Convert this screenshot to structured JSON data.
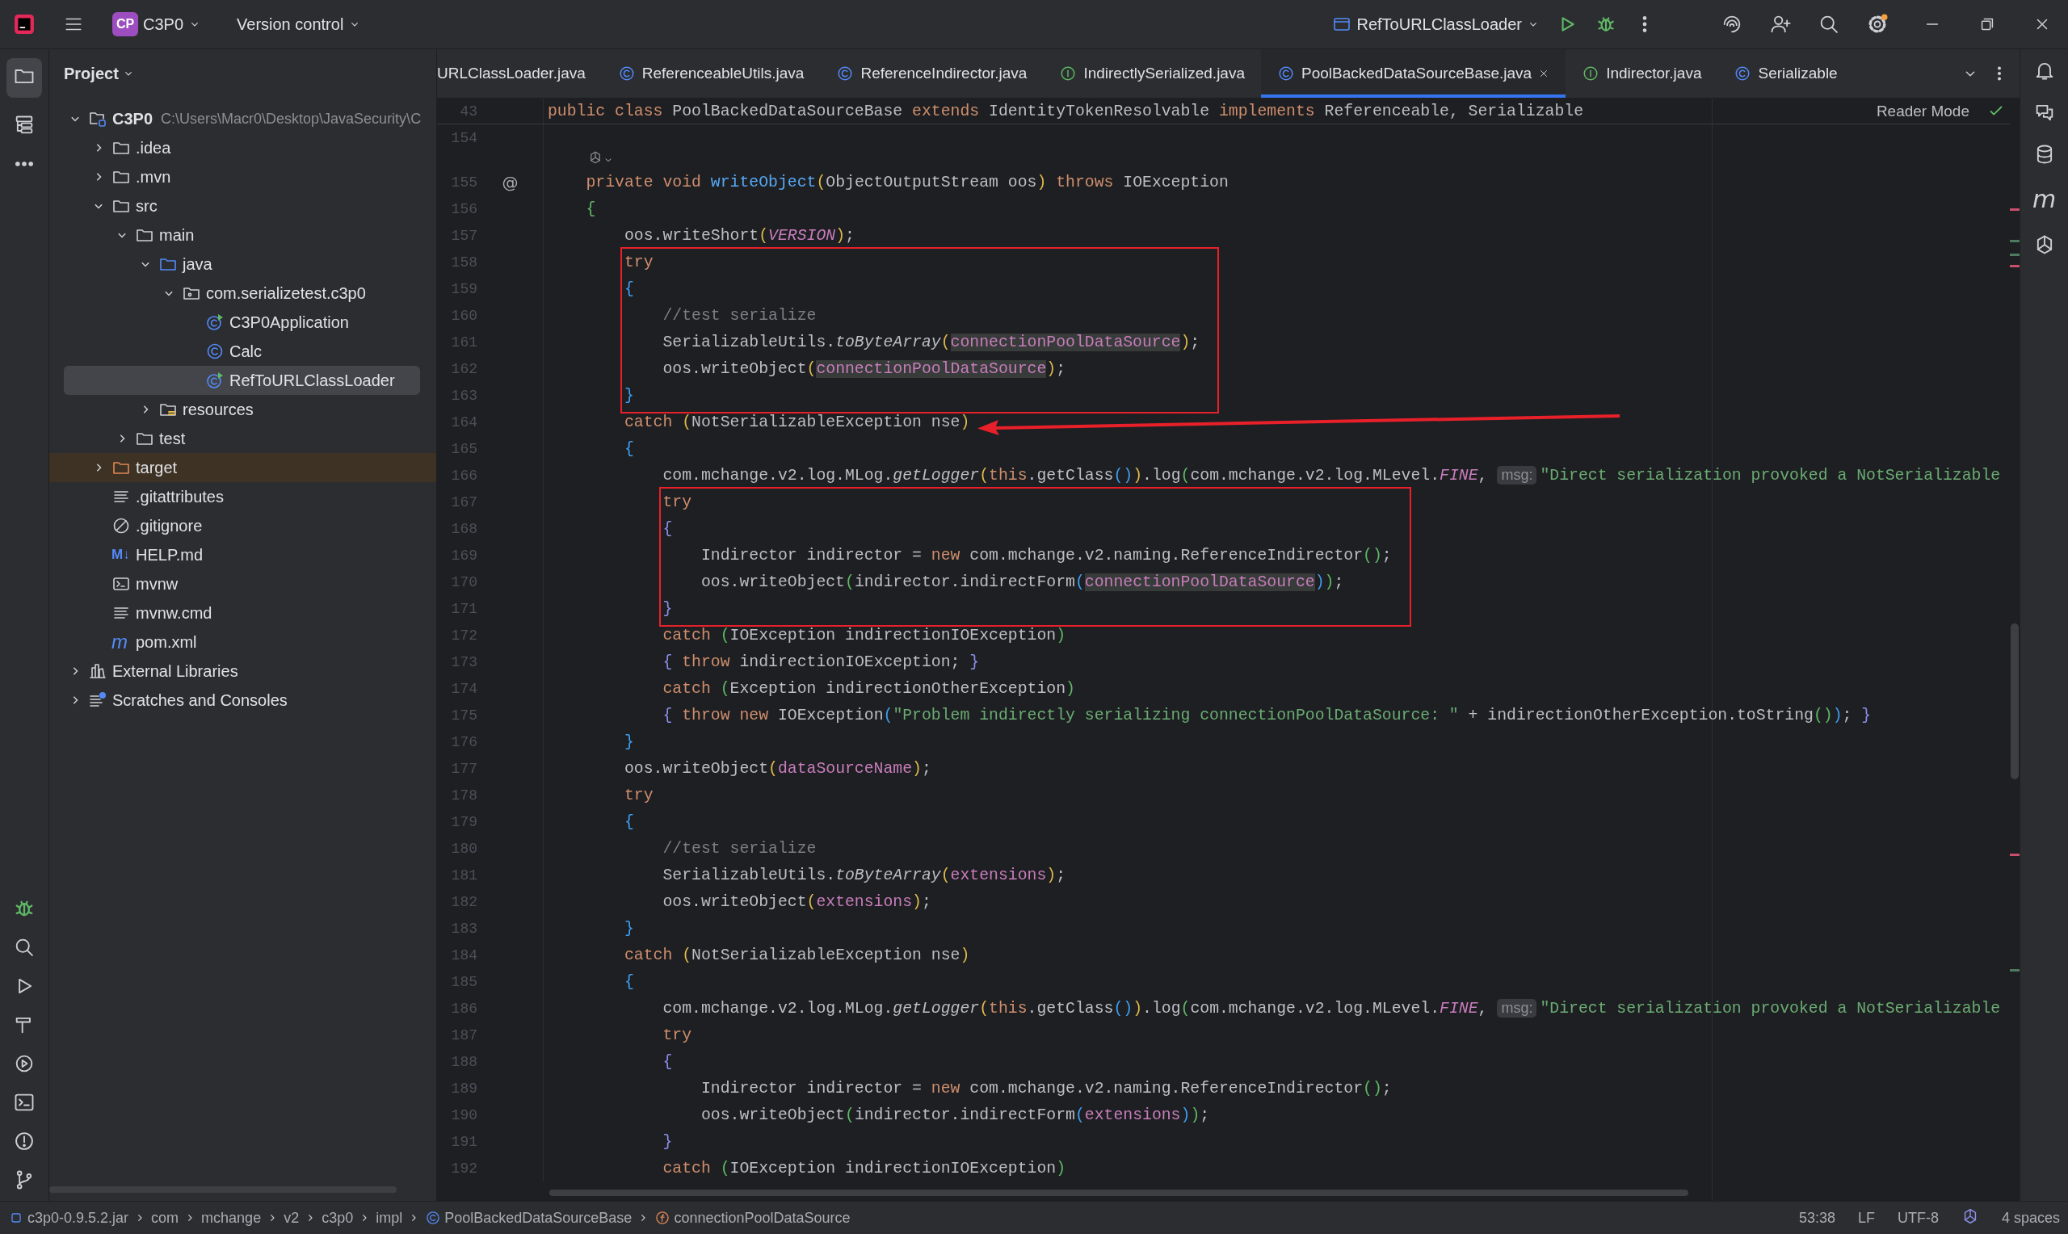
{
  "title_bar": {
    "project_badge": "CP",
    "project_name": "C3P0",
    "vcs_label": "Version control",
    "run_config": "RefToURLClassLoader"
  },
  "project_panel": {
    "title": "Project",
    "tree": [
      {
        "name": "C3P0",
        "path": "C:\\Users\\Macr0\\Desktop\\JavaSecurity\\C",
        "kind": "module",
        "expanded": true,
        "selected": false,
        "children": [
          {
            "name": ".idea",
            "kind": "folder",
            "expanded": false,
            "selected": false
          },
          {
            "name": ".mvn",
            "kind": "folder",
            "expanded": false,
            "selected": false
          },
          {
            "name": "src",
            "kind": "folder",
            "expanded": true,
            "selected": false,
            "children": [
              {
                "name": "main",
                "kind": "folder",
                "expanded": true,
                "selected": false,
                "children": [
                  {
                    "name": "java",
                    "kind": "source-folder",
                    "expanded": true,
                    "selected": false,
                    "children": [
                      {
                        "name": "com.serializetest.c3p0",
                        "kind": "package",
                        "expanded": true,
                        "selected": false,
                        "children": [
                          {
                            "name": "C3P0Application",
                            "kind": "main-class",
                            "selected": false
                          },
                          {
                            "name": "Calc",
                            "kind": "class",
                            "selected": false
                          },
                          {
                            "name": "RefToURLClassLoader",
                            "kind": "main-class",
                            "selected": true
                          }
                        ]
                      }
                    ]
                  },
                  {
                    "name": "resources",
                    "kind": "resources",
                    "expanded": false,
                    "selected": false
                  }
                ]
              },
              {
                "name": "test",
                "kind": "folder",
                "expanded": false,
                "selected": false
              }
            ]
          },
          {
            "name": "target",
            "kind": "excluded-folder",
            "expanded": false,
            "selected": false
          },
          {
            "name": ".gitattributes",
            "kind": "text",
            "selected": false
          },
          {
            "name": ".gitignore",
            "kind": "ignore",
            "selected": false
          },
          {
            "name": "HELP.md",
            "kind": "glyph",
            "icon_text": "M↓",
            "selected": false
          },
          {
            "name": "mvnw",
            "kind": "script",
            "selected": false
          },
          {
            "name": "mvnw.cmd",
            "kind": "text",
            "selected": false
          },
          {
            "name": "pom.xml",
            "kind": "glyph",
            "icon_text": "m",
            "selected": false
          }
        ]
      },
      {
        "name": "External Libraries",
        "kind": "libraries",
        "expanded": false,
        "selected": false
      },
      {
        "name": "Scratches and Consoles",
        "kind": "scratches",
        "expanded": false,
        "selected": false
      }
    ]
  },
  "editor": {
    "tabs": [
      {
        "label": "URLClassLoader.java",
        "selected": false
      },
      {
        "label": "ReferenceableUtils.java",
        "kind": "class",
        "selected": false
      },
      {
        "label": "ReferenceIndirector.java",
        "kind": "class",
        "selected": false
      },
      {
        "label": "IndirectlySerialized.java",
        "kind": "interface",
        "selected": false
      },
      {
        "label": "PoolBackedDataSourceBase.java",
        "kind": "class",
        "selected": true
      },
      {
        "label": "Indirector.java",
        "kind": "interface",
        "selected": false
      },
      {
        "label": "Serializable",
        "kind": "class",
        "selected": false
      }
    ],
    "reader_mode": "Reader Mode",
    "sticky_line": {
      "number": "43",
      "tokens": [
        {
          "text": "public class ",
          "kind": "kw"
        },
        {
          "text": "PoolBackedDataSourceBase ",
          "kind": "plain"
        },
        {
          "text": "extends ",
          "kind": "kw"
        },
        {
          "text": "IdentityTokenResolvable ",
          "kind": "plain"
        },
        {
          "text": "implements ",
          "kind": "kw"
        },
        {
          "text": "Referenceable, Serializable",
          "kind": "plain"
        }
      ]
    },
    "blocks": [
      {
        "kind": "plain",
        "lines": [
          {
            "kind": "code",
            "number": "154"
          },
          {
            "kind": "inlay"
          },
          {
            "kind": "code",
            "number": "155",
            "marker": "@",
            "tokens": [
              {
                "text": "    private void ",
                "kind": "kw"
              },
              {
                "text": "writeObject",
                "kind": "fn"
              },
              {
                "text": "(",
                "kind": "y"
              },
              {
                "text": "ObjectOutputStream oos",
                "kind": "plain"
              },
              {
                "text": ")",
                "kind": "y"
              },
              {
                "text": " throws ",
                "kind": "kw"
              },
              {
                "text": "IOException",
                "kind": "plain"
              }
            ]
          },
          {
            "kind": "code",
            "number": "156",
            "tokens": [
              {
                "text": "    {",
                "kind": "g"
              }
            ]
          },
          {
            "kind": "code",
            "number": "157",
            "tokens": [
              {
                "text": "        oos.writeShort",
                "kind": "plain"
              },
              {
                "text": "(",
                "kind": "y"
              },
              {
                "text": "VERSION",
                "kind": "const"
              },
              {
                "text": ")",
                "kind": "y"
              },
              {
                "text": ";",
                "kind": "plain"
              }
            ]
          }
        ]
      },
      {
        "kind": "boxed",
        "lines": [
          {
            "kind": "code",
            "number": "158",
            "tokens": [
              {
                "text": "        try",
                "kind": "kw"
              }
            ]
          },
          {
            "kind": "code",
            "number": "159",
            "tokens": [
              {
                "text": "        {",
                "kind": "b"
              }
            ]
          },
          {
            "kind": "code",
            "number": "160",
            "tokens": [
              {
                "text": "            //test serialize",
                "kind": "comment"
              }
            ]
          },
          {
            "kind": "code",
            "number": "161",
            "tokens": [
              {
                "text": "            SerializableUtils.",
                "kind": "plain"
              },
              {
                "text": "toByteArray",
                "kind": "static"
              },
              {
                "text": "(",
                "kind": "y"
              },
              {
                "text": "connectionPoolDataSource",
                "kind": "field-hl"
              },
              {
                "text": ")",
                "kind": "y"
              },
              {
                "text": ";",
                "kind": "plain"
              }
            ]
          },
          {
            "kind": "code",
            "number": "162",
            "tokens": [
              {
                "text": "            oos.writeObject",
                "kind": "plain"
              },
              {
                "text": "(",
                "kind": "y"
              },
              {
                "text": "connectionPoolDataSource",
                "kind": "field-hl"
              },
              {
                "text": ")",
                "kind": "y"
              },
              {
                "text": ";",
                "kind": "plain"
              }
            ]
          },
          {
            "kind": "code",
            "number": "163",
            "tokens": [
              {
                "text": "        }",
                "kind": "b"
              }
            ]
          }
        ]
      },
      {
        "kind": "arrow",
        "lines": [
          {
            "kind": "code",
            "number": "164",
            "tokens": [
              {
                "text": "        catch ",
                "kind": "kw"
              },
              {
                "text": "(",
                "kind": "y"
              },
              {
                "text": "NotSerializableException nse",
                "kind": "plain"
              },
              {
                "text": ")",
                "kind": "y"
              }
            ]
          }
        ]
      },
      {
        "kind": "plain",
        "lines": [
          {
            "kind": "code",
            "number": "165",
            "tokens": [
              {
                "text": "        {",
                "kind": "b"
              }
            ]
          },
          {
            "kind": "code",
            "number": "166",
            "tokens": [
              {
                "text": "            com.mchange.v2.log.MLog.",
                "kind": "plain"
              },
              {
                "text": "getLogger",
                "kind": "static"
              },
              {
                "text": "(",
                "kind": "y"
              },
              {
                "text": "this",
                "kind": "kw"
              },
              {
                "text": ".getClass",
                "kind": "plain"
              },
              {
                "text": "()",
                "kind": "b"
              },
              {
                "text": ")",
                "kind": "y"
              },
              {
                "text": ".log",
                "kind": "plain"
              },
              {
                "text": "(",
                "kind": "g"
              },
              {
                "text": "com.mchange.v2.log.MLevel.",
                "kind": "plain"
              },
              {
                "text": "FINE",
                "kind": "const"
              },
              {
                "text": ",",
                "kind": "plain"
              },
              {
                "text": "msg:",
                "kind": "hint"
              },
              {
                "text": "\"Direct serialization provoked a NotSerializable",
                "kind": "str"
              }
            ]
          }
        ]
      },
      {
        "kind": "boxed",
        "lines": [
          {
            "kind": "code",
            "number": "167",
            "tokens": [
              {
                "text": "            try",
                "kind": "kw"
              }
            ]
          },
          {
            "kind": "code",
            "number": "168",
            "tokens": [
              {
                "text": "            {",
                "kind": "v"
              }
            ]
          },
          {
            "kind": "code",
            "number": "169",
            "tokens": [
              {
                "text": "                Indirector indirector = ",
                "kind": "plain"
              },
              {
                "text": "new ",
                "kind": "kw"
              },
              {
                "text": "com.mchange.v2.naming.ReferenceIndirector",
                "kind": "plain"
              },
              {
                "text": "()",
                "kind": "g"
              },
              {
                "text": ";",
                "kind": "plain"
              }
            ]
          },
          {
            "kind": "code",
            "number": "170",
            "tokens": [
              {
                "text": "                oos.writeObject",
                "kind": "plain"
              },
              {
                "text": "(",
                "kind": "g"
              },
              {
                "text": "indirector.indirectForm",
                "kind": "plain"
              },
              {
                "text": "(",
                "kind": "b"
              },
              {
                "text": "connectionPoolDataSource",
                "kind": "field-hl"
              },
              {
                "text": ")",
                "kind": "b"
              },
              {
                "text": ")",
                "kind": "g"
              },
              {
                "text": ";",
                "kind": "plain"
              }
            ]
          },
          {
            "kind": "code",
            "number": "171",
            "tokens": [
              {
                "text": "            }",
                "kind": "v"
              }
            ]
          }
        ]
      },
      {
        "kind": "plain",
        "lines": [
          {
            "kind": "code",
            "number": "172",
            "tokens": [
              {
                "text": "            catch ",
                "kind": "kw"
              },
              {
                "text": "(",
                "kind": "g"
              },
              {
                "text": "IOException indirectionIOException",
                "kind": "plain"
              },
              {
                "text": ")",
                "kind": "g"
              }
            ]
          },
          {
            "kind": "code",
            "number": "173",
            "tokens": [
              {
                "text": "            { ",
                "kind": "v"
              },
              {
                "text": "throw ",
                "kind": "kw"
              },
              {
                "text": "indirectionIOException; ",
                "kind": "plain"
              },
              {
                "text": "}",
                "kind": "v"
              }
            ]
          },
          {
            "kind": "code",
            "number": "174",
            "tokens": [
              {
                "text": "            catch ",
                "kind": "kw"
              },
              {
                "text": "(",
                "kind": "g"
              },
              {
                "text": "Exception indirectionOtherException",
                "kind": "plain"
              },
              {
                "text": ")",
                "kind": "g"
              }
            ]
          },
          {
            "kind": "code",
            "number": "175",
            "tokens": [
              {
                "text": "            { ",
                "kind": "v"
              },
              {
                "text": "throw new ",
                "kind": "kw"
              },
              {
                "text": "IOException",
                "kind": "plain"
              },
              {
                "text": "(",
                "kind": "b"
              },
              {
                "text": "\"Problem indirectly serializing connectionPoolDataSource: \"",
                "kind": "str"
              },
              {
                "text": " + indirectionOtherException.toString",
                "kind": "plain"
              },
              {
                "text": "()",
                "kind": "g"
              },
              {
                "text": ")",
                "kind": "b"
              },
              {
                "text": "; ",
                "kind": "plain"
              },
              {
                "text": "}",
                "kind": "v"
              }
            ]
          },
          {
            "kind": "code",
            "number": "176",
            "tokens": [
              {
                "text": "        }",
                "kind": "b"
              }
            ]
          },
          {
            "kind": "code",
            "number": "177",
            "tokens": [
              {
                "text": "        oos.writeObject",
                "kind": "plain"
              },
              {
                "text": "(",
                "kind": "y"
              },
              {
                "text": "dataSourceName",
                "kind": "field"
              },
              {
                "text": ")",
                "kind": "y"
              },
              {
                "text": ";",
                "kind": "plain"
              }
            ]
          },
          {
            "kind": "code",
            "number": "178",
            "tokens": [
              {
                "text": "        try",
                "kind": "kw"
              }
            ]
          },
          {
            "kind": "code",
            "number": "179",
            "tokens": [
              {
                "text": "        {",
                "kind": "b"
              }
            ]
          },
          {
            "kind": "code",
            "number": "180",
            "tokens": [
              {
                "text": "            //test serialize",
                "kind": "comment"
              }
            ]
          },
          {
            "kind": "code",
            "number": "181",
            "tokens": [
              {
                "text": "            SerializableUtils.",
                "kind": "plain"
              },
              {
                "text": "toByteArray",
                "kind": "static"
              },
              {
                "text": "(",
                "kind": "y"
              },
              {
                "text": "extensions",
                "kind": "field"
              },
              {
                "text": ")",
                "kind": "y"
              },
              {
                "text": ";",
                "kind": "plain"
              }
            ]
          },
          {
            "kind": "code",
            "number": "182",
            "tokens": [
              {
                "text": "            oos.writeObject",
                "kind": "plain"
              },
              {
                "text": "(",
                "kind": "y"
              },
              {
                "text": "extensions",
                "kind": "field"
              },
              {
                "text": ")",
                "kind": "y"
              },
              {
                "text": ";",
                "kind": "plain"
              }
            ]
          },
          {
            "kind": "code",
            "number": "183",
            "tokens": [
              {
                "text": "        }",
                "kind": "b"
              }
            ]
          },
          {
            "kind": "code",
            "number": "184",
            "tokens": [
              {
                "text": "        catch ",
                "kind": "kw"
              },
              {
                "text": "(",
                "kind": "y"
              },
              {
                "text": "NotSerializableException nse",
                "kind": "plain"
              },
              {
                "text": ")",
                "kind": "y"
              }
            ]
          },
          {
            "kind": "code",
            "number": "185",
            "tokens": [
              {
                "text": "        {",
                "kind": "b"
              }
            ]
          },
          {
            "kind": "code",
            "number": "186",
            "tokens": [
              {
                "text": "            com.mchange.v2.log.MLog.",
                "kind": "plain"
              },
              {
                "text": "getLogger",
                "kind": "static"
              },
              {
                "text": "(",
                "kind": "y"
              },
              {
                "text": "this",
                "kind": "kw"
              },
              {
                "text": ".getClass",
                "kind": "plain"
              },
              {
                "text": "()",
                "kind": "b"
              },
              {
                "text": ")",
                "kind": "y"
              },
              {
                "text": ".log",
                "kind": "plain"
              },
              {
                "text": "(",
                "kind": "g"
              },
              {
                "text": "com.mchange.v2.log.MLevel.",
                "kind": "plain"
              },
              {
                "text": "FINE",
                "kind": "const"
              },
              {
                "text": ",",
                "kind": "plain"
              },
              {
                "text": "msg:",
                "kind": "hint"
              },
              {
                "text": "\"Direct serialization provoked a NotSerializable",
                "kind": "str"
              }
            ]
          },
          {
            "kind": "code",
            "number": "187",
            "tokens": [
              {
                "text": "            try",
                "kind": "kw"
              }
            ]
          },
          {
            "kind": "code",
            "number": "188",
            "tokens": [
              {
                "text": "            {",
                "kind": "v"
              }
            ]
          },
          {
            "kind": "code",
            "number": "189",
            "tokens": [
              {
                "text": "                Indirector indirector = ",
                "kind": "plain"
              },
              {
                "text": "new ",
                "kind": "kw"
              },
              {
                "text": "com.mchange.v2.naming.ReferenceIndirector",
                "kind": "plain"
              },
              {
                "text": "()",
                "kind": "g"
              },
              {
                "text": ";",
                "kind": "plain"
              }
            ]
          },
          {
            "kind": "code",
            "number": "190",
            "tokens": [
              {
                "text": "                oos.writeObject",
                "kind": "plain"
              },
              {
                "text": "(",
                "kind": "g"
              },
              {
                "text": "indirector.indirectForm",
                "kind": "plain"
              },
              {
                "text": "(",
                "kind": "b"
              },
              {
                "text": "extensions",
                "kind": "field"
              },
              {
                "text": ")",
                "kind": "b"
              },
              {
                "text": ")",
                "kind": "g"
              },
              {
                "text": ";",
                "kind": "plain"
              }
            ]
          },
          {
            "kind": "code",
            "number": "191",
            "tokens": [
              {
                "text": "            }",
                "kind": "v"
              }
            ]
          },
          {
            "kind": "code",
            "number": "192",
            "tokens": [
              {
                "text": "            catch ",
                "kind": "kw"
              },
              {
                "text": "(",
                "kind": "g"
              },
              {
                "text": "IOException indirectionIOException",
                "kind": "plain"
              },
              {
                "text": ")",
                "kind": "g"
              }
            ]
          }
        ]
      }
    ]
  },
  "right_toolbar": {
    "maven_glyph": "m"
  },
  "status_bar": {
    "breadcrumbs": [
      {
        "text": "c3p0-0.9.5.2.jar",
        "kind": "jar"
      },
      {
        "text": "com",
        "kind": "package"
      },
      {
        "text": "mchange",
        "kind": "package"
      },
      {
        "text": "v2",
        "kind": "package"
      },
      {
        "text": "c3p0",
        "kind": "package"
      },
      {
        "text": "impl",
        "kind": "package"
      },
      {
        "text": "PoolBackedDataSourceBase",
        "kind": "class"
      },
      {
        "text": "connectionPoolDataSource",
        "kind": "field"
      }
    ],
    "position": "53:38",
    "line_separator": "LF",
    "encoding": "UTF-8",
    "indent": "4 spaces"
  }
}
